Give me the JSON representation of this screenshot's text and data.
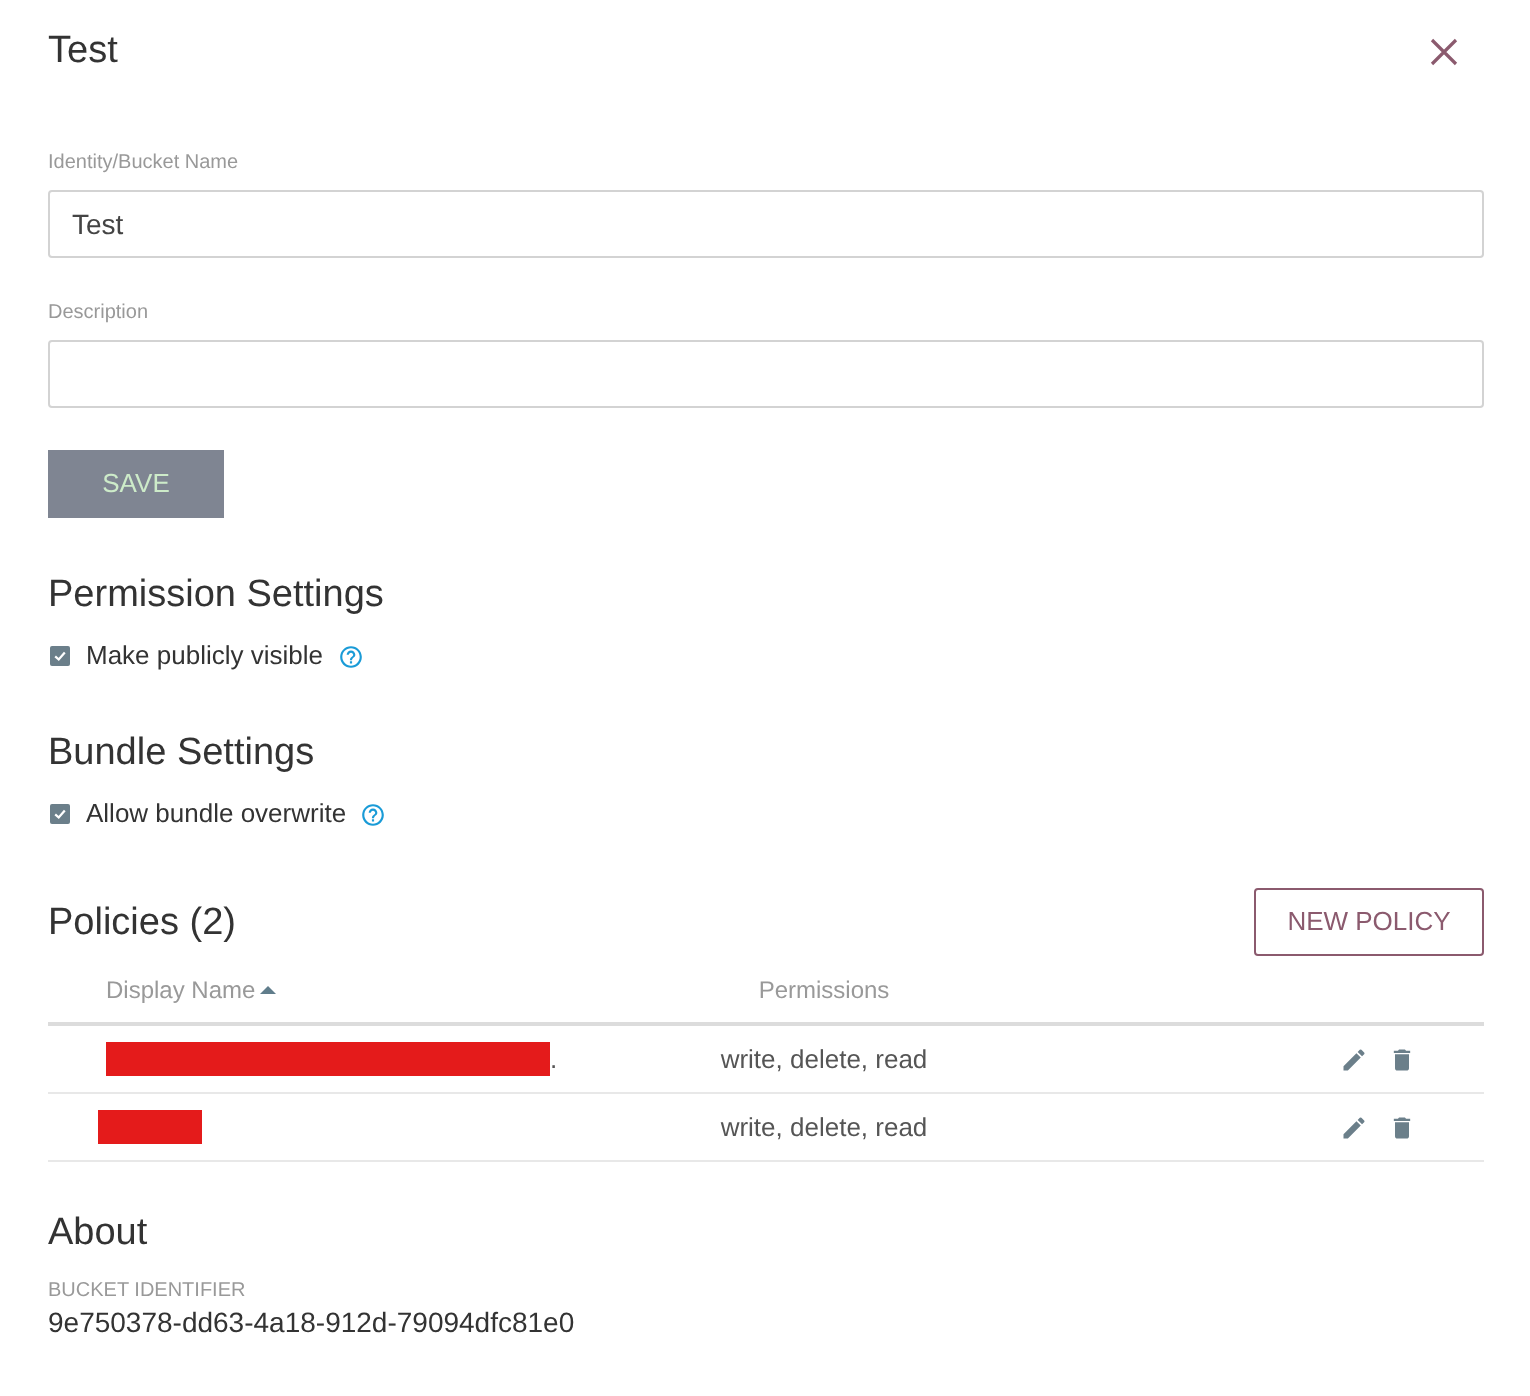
{
  "dialog": {
    "title": "Test"
  },
  "fields": [
    {
      "label": "Identity/Bucket Name",
      "value": "Test"
    },
    {
      "label": "Description"
    }
  ],
  "save_button": {
    "label": "SAVE",
    "disabled": true
  },
  "settings": [
    {
      "title": "Permission Settings",
      "options": [
        {
          "label": "Make publicly visible",
          "checked": true
        }
      ]
    },
    {
      "title": "Bundle Settings",
      "options": [
        {
          "label": "Allow bundle overwrite",
          "checked": true
        }
      ]
    }
  ],
  "policies": {
    "title": "Policies (2)",
    "new_button": "NEW POLICY",
    "columns": [
      {
        "label": "Display Name",
        "sort_ascending": true
      },
      {
        "label": "Permissions"
      }
    ],
    "rows": [
      {
        "redacted": true,
        "name_tail": ".",
        "permissions": "write, delete, read"
      },
      {
        "redacted": true,
        "permissions": "write, delete, read"
      }
    ]
  },
  "about": {
    "title": "About",
    "identifier_label": "BUCKET IDENTIFIER",
    "identifier": "9e750378-dd63-4a18-912d-79094dfc81e0"
  }
}
